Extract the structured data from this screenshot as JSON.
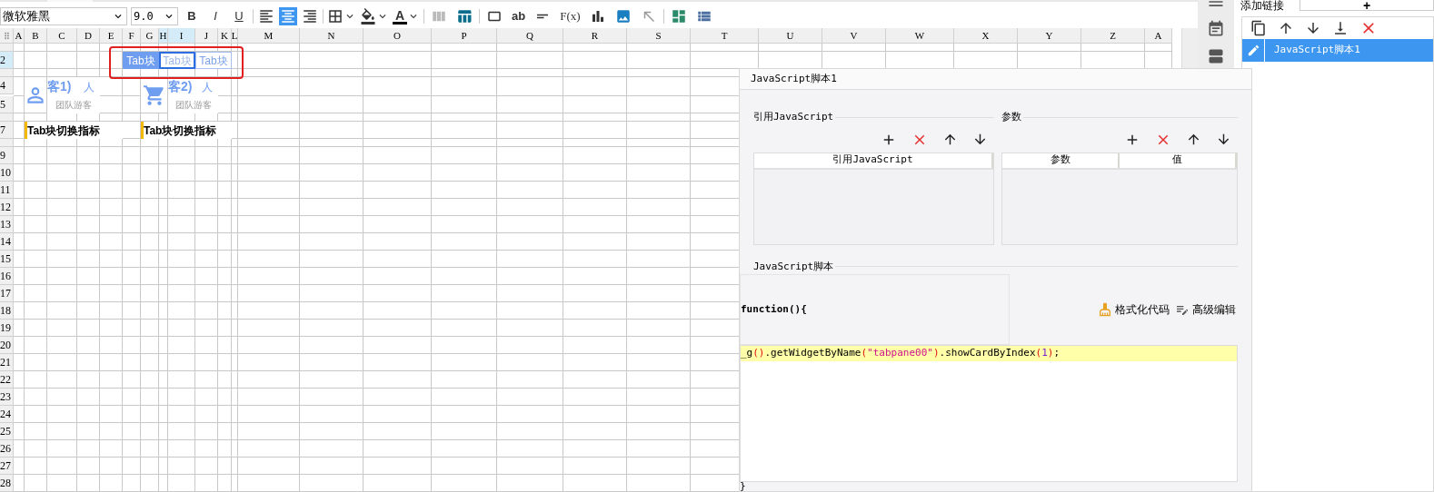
{
  "toolbar": {
    "font": "微软雅黑",
    "size": "9.0",
    "buttons": [
      {
        "kind": "bold",
        "label": "B"
      },
      {
        "kind": "italic",
        "label": "I"
      },
      {
        "kind": "underline",
        "label": "U"
      }
    ],
    "align": [
      {
        "kind": "left",
        "selected": false
      },
      {
        "kind": "center",
        "selected": true
      },
      {
        "kind": "right",
        "selected": false
      }
    ],
    "font_color": {
      "label": "A",
      "color": "#000000"
    },
    "text_buttons": [
      {
        "kind": "ab",
        "label": "ab"
      },
      {
        "kind": "formula",
        "label": "F(x)"
      }
    ]
  },
  "sheet": {
    "columns": [
      {
        "label": "A",
        "selected": false
      },
      {
        "label": "B",
        "selected": false
      },
      {
        "label": "C",
        "selected": false
      },
      {
        "label": "D",
        "selected": false
      },
      {
        "label": "E",
        "selected": false
      },
      {
        "label": "F",
        "selected": false
      },
      {
        "label": "G",
        "selected": false
      },
      {
        "label": "H",
        "selected": true
      },
      {
        "label": "I",
        "selected": true
      },
      {
        "label": "J",
        "selected": false
      },
      {
        "label": "K",
        "selected": false
      },
      {
        "label": "L",
        "selected": false
      },
      {
        "label": "M",
        "selected": false
      },
      {
        "label": "N",
        "selected": false
      },
      {
        "label": "O",
        "selected": false
      },
      {
        "label": "P",
        "selected": false
      },
      {
        "label": "Q",
        "selected": false
      },
      {
        "label": "R",
        "selected": false
      },
      {
        "label": "S",
        "selected": false
      },
      {
        "label": "T",
        "selected": false
      },
      {
        "label": "U",
        "selected": false
      },
      {
        "label": "V",
        "selected": false
      },
      {
        "label": "W",
        "selected": false
      },
      {
        "label": "X",
        "selected": false
      },
      {
        "label": "Y",
        "selected": false
      },
      {
        "label": "Z",
        "selected": false
      },
      {
        "label": "A",
        "selected": false
      }
    ],
    "rows": [
      {
        "kind": "short"
      },
      {
        "kind": "normal",
        "label": "2",
        "selected": true
      },
      {
        "kind": "short"
      },
      {
        "kind": "normal",
        "label": "4",
        "selected": false
      },
      {
        "kind": "normal",
        "label": "5",
        "selected": false
      },
      {
        "kind": "short"
      },
      {
        "kind": "normal",
        "label": "7",
        "selected": false
      },
      {
        "kind": "short"
      },
      {
        "kind": "normal",
        "label": "9",
        "selected": false
      },
      {
        "kind": "normal",
        "label": "10",
        "selected": false
      },
      {
        "kind": "normal",
        "label": "11",
        "selected": false
      },
      {
        "kind": "normal",
        "label": "12",
        "selected": false
      },
      {
        "kind": "normal",
        "label": "13",
        "selected": false
      },
      {
        "kind": "normal",
        "label": "14",
        "selected": false
      },
      {
        "kind": "normal",
        "label": "15",
        "selected": false
      },
      {
        "kind": "normal",
        "label": "16",
        "selected": false
      },
      {
        "kind": "normal",
        "label": "17",
        "selected": false
      },
      {
        "kind": "normal",
        "label": "18",
        "selected": false
      },
      {
        "kind": "normal",
        "label": "19",
        "selected": false
      },
      {
        "kind": "normal",
        "label": "20",
        "selected": false
      },
      {
        "kind": "normal",
        "label": "21",
        "selected": false
      },
      {
        "kind": "normal",
        "label": "22",
        "selected": false
      },
      {
        "kind": "normal",
        "label": "23",
        "selected": false
      },
      {
        "kind": "normal",
        "label": "24",
        "selected": false
      },
      {
        "kind": "normal",
        "label": "25",
        "selected": false
      },
      {
        "kind": "normal",
        "label": "26",
        "selected": false
      },
      {
        "kind": "normal",
        "label": "27",
        "selected": false
      },
      {
        "kind": "normal",
        "label": "28",
        "selected": false
      }
    ],
    "tab_blocks": [
      {
        "text": "Tab块",
        "kind": "filled",
        "selected": false
      },
      {
        "text": "Tab块",
        "kind": "outlined",
        "selected": true
      },
      {
        "text": "Tab块",
        "kind": "outlined",
        "selected": false
      }
    ],
    "cards": [
      {
        "kind": "person",
        "title": "客1)",
        "unit": "人",
        "caption": "团队游客"
      },
      {
        "kind": "cart",
        "title": "客2)",
        "unit": "人",
        "caption": "团队游客"
      }
    ],
    "labels": [
      "Tab块切换指标",
      "Tab块切换指标"
    ]
  },
  "side_panel": {
    "tab": "添加链接",
    "add": "+",
    "items": [
      {
        "label": "JavaScript脚本1",
        "selected": true
      }
    ]
  },
  "dialog": {
    "title": "JavaScript脚本1",
    "import_section": {
      "title": "引用JavaScript",
      "columns": [
        "引用JavaScript"
      ]
    },
    "params_section": {
      "title": "参数",
      "columns": [
        "参数",
        "值"
      ]
    },
    "script_section": {
      "title": "JavaScript脚本",
      "header": "function(){",
      "buttons": [
        "格式化代码",
        "高级编辑"
      ],
      "code": [
        {
          "text": "_g",
          "kind": "plain"
        },
        {
          "text": "()",
          "kind": "paren"
        },
        {
          "text": ".getWidgetByName",
          "kind": "plain"
        },
        {
          "text": "(",
          "kind": "paren"
        },
        {
          "text": "\"tabpane00\"",
          "kind": "string"
        },
        {
          "text": ")",
          "kind": "paren"
        },
        {
          "text": ".showCardByIndex",
          "kind": "plain"
        },
        {
          "text": "(",
          "kind": "paren"
        },
        {
          "text": "1",
          "kind": "number"
        },
        {
          "text": ")",
          "kind": "paren"
        },
        {
          "text": ";",
          "kind": "plain"
        }
      ],
      "footer": "}"
    }
  }
}
